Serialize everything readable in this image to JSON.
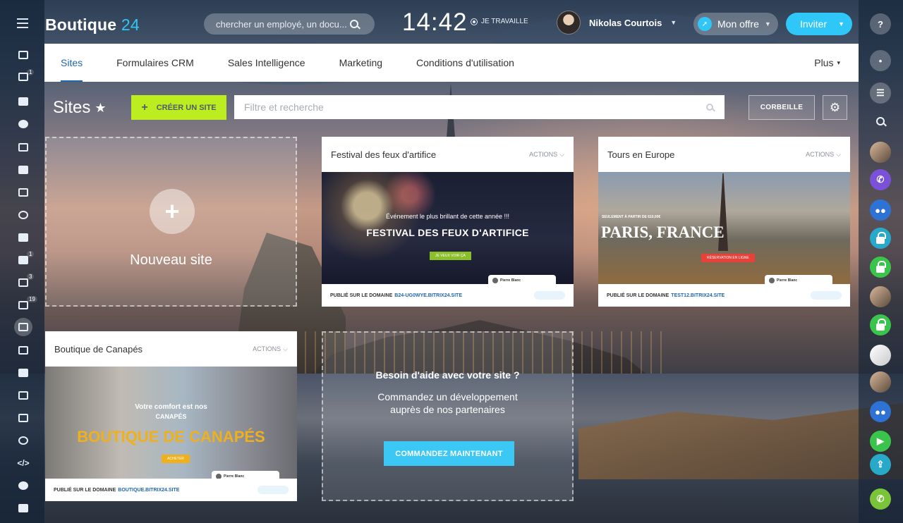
{
  "header": {
    "brand_name": "Boutique",
    "brand_num": "24",
    "search_placeholder": "chercher un employé, un docu...",
    "clock": "14:42",
    "status": "JE TRAVAILLE",
    "user_name": "Nikolas Courtois",
    "offer_label": "Mon offre",
    "invite_label": "Inviter"
  },
  "tabs": {
    "items": [
      "Sites",
      "Formulaires CRM",
      "Sales Intelligence",
      "Marketing",
      "Conditions d'utilisation"
    ],
    "more": "Plus"
  },
  "toolbar": {
    "title": "Sites",
    "create_label": "CRÉER UN SITE",
    "filter_placeholder": "Filtre et recherche",
    "trash_label": "CORBEILLE"
  },
  "new_site": {
    "label": "Nouveau site"
  },
  "cards": [
    {
      "name": "Festival des feux d'artifice",
      "actions": "ACTIONS",
      "preview_sub": "Événement le plus brillant de cette année !!!",
      "preview_title": "FESTIVAL DES FEUX D'ARTIFICE",
      "preview_button": "JE VEUX VOIR ÇA",
      "preview_card_name": "Pierre Blanc",
      "foot_label": "PUBLIÉ SUR LE DOMAINE",
      "domain": "B24-UG0WYE.BITRIX24.SITE"
    },
    {
      "name": "Tours en Europe",
      "actions": "ACTIONS",
      "preview_sub": "SEULEMENT À PARTIR DE 610,00€",
      "preview_title": "PARIS, FRANCE",
      "preview_button": "RÉSERVATION EN LIGNE",
      "preview_card_name": "Pierre Blanc",
      "foot_label": "PUBLIÉ SUR LE DOMAINE",
      "domain": "TEST12.BITRIX24.SITE"
    },
    {
      "name": "Boutique de Canapés",
      "actions": "ACTIONS",
      "preview_sub": "Votre comfort est nos",
      "preview_sub2": "CANAPÉS",
      "preview_title": "BOUTIQUE DE CANAPÉS",
      "preview_button": "ACHETER",
      "preview_card_name": "Pierre Blanc",
      "foot_label": "PUBLIÉ SUR LE DOMAINE",
      "domain": "BOUTIQUE.BITRIX24.SITE"
    }
  ],
  "help": {
    "title": "Besoin d'aide avec votre site ?",
    "text": "Commandez un développement auprès de nos partenaires",
    "button": "COMMANDEZ MAINTENANT"
  },
  "left_sidebar": {
    "badges": [
      "1",
      "1",
      "3",
      "19"
    ]
  },
  "right_sidebar": {
    "icons": [
      "help-icon",
      "bell-icon",
      "chat-icon",
      "search-icon",
      "user-avatar",
      "viber-icon",
      "group-chat-icon",
      "lock-icon",
      "lock-icon",
      "user-avatar",
      "lock-icon",
      "marketing-avatar",
      "user-avatar",
      "group-icon",
      "video-icon",
      "share-icon",
      "phone-icon"
    ]
  },
  "colors": {
    "accent": "#2fc7f7",
    "create_button": "#bbed21",
    "tab_active": "#2067b0",
    "help_button": "#3bc8f5"
  }
}
